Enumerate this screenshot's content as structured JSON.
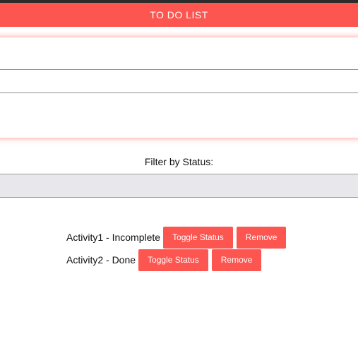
{
  "header": {
    "title": "TO DO LIST"
  },
  "form": {
    "field_1_value": "",
    "field_2_value": "",
    "field_3_value": ""
  },
  "filter": {
    "label": "Filter by Status:",
    "selected_value": ""
  },
  "todos": [
    {
      "text": "Activity1 - Incomplete",
      "toggle_label": "Toggle Status",
      "remove_label": "Remove"
    },
    {
      "text": "Activity2 - Done",
      "toggle_label": "Toggle Status",
      "remove_label": "Remove"
    }
  ],
  "colors": {
    "accent": "#fd5550",
    "topbar": "#2b2b2b",
    "select_bg": "#e8e8ec"
  }
}
